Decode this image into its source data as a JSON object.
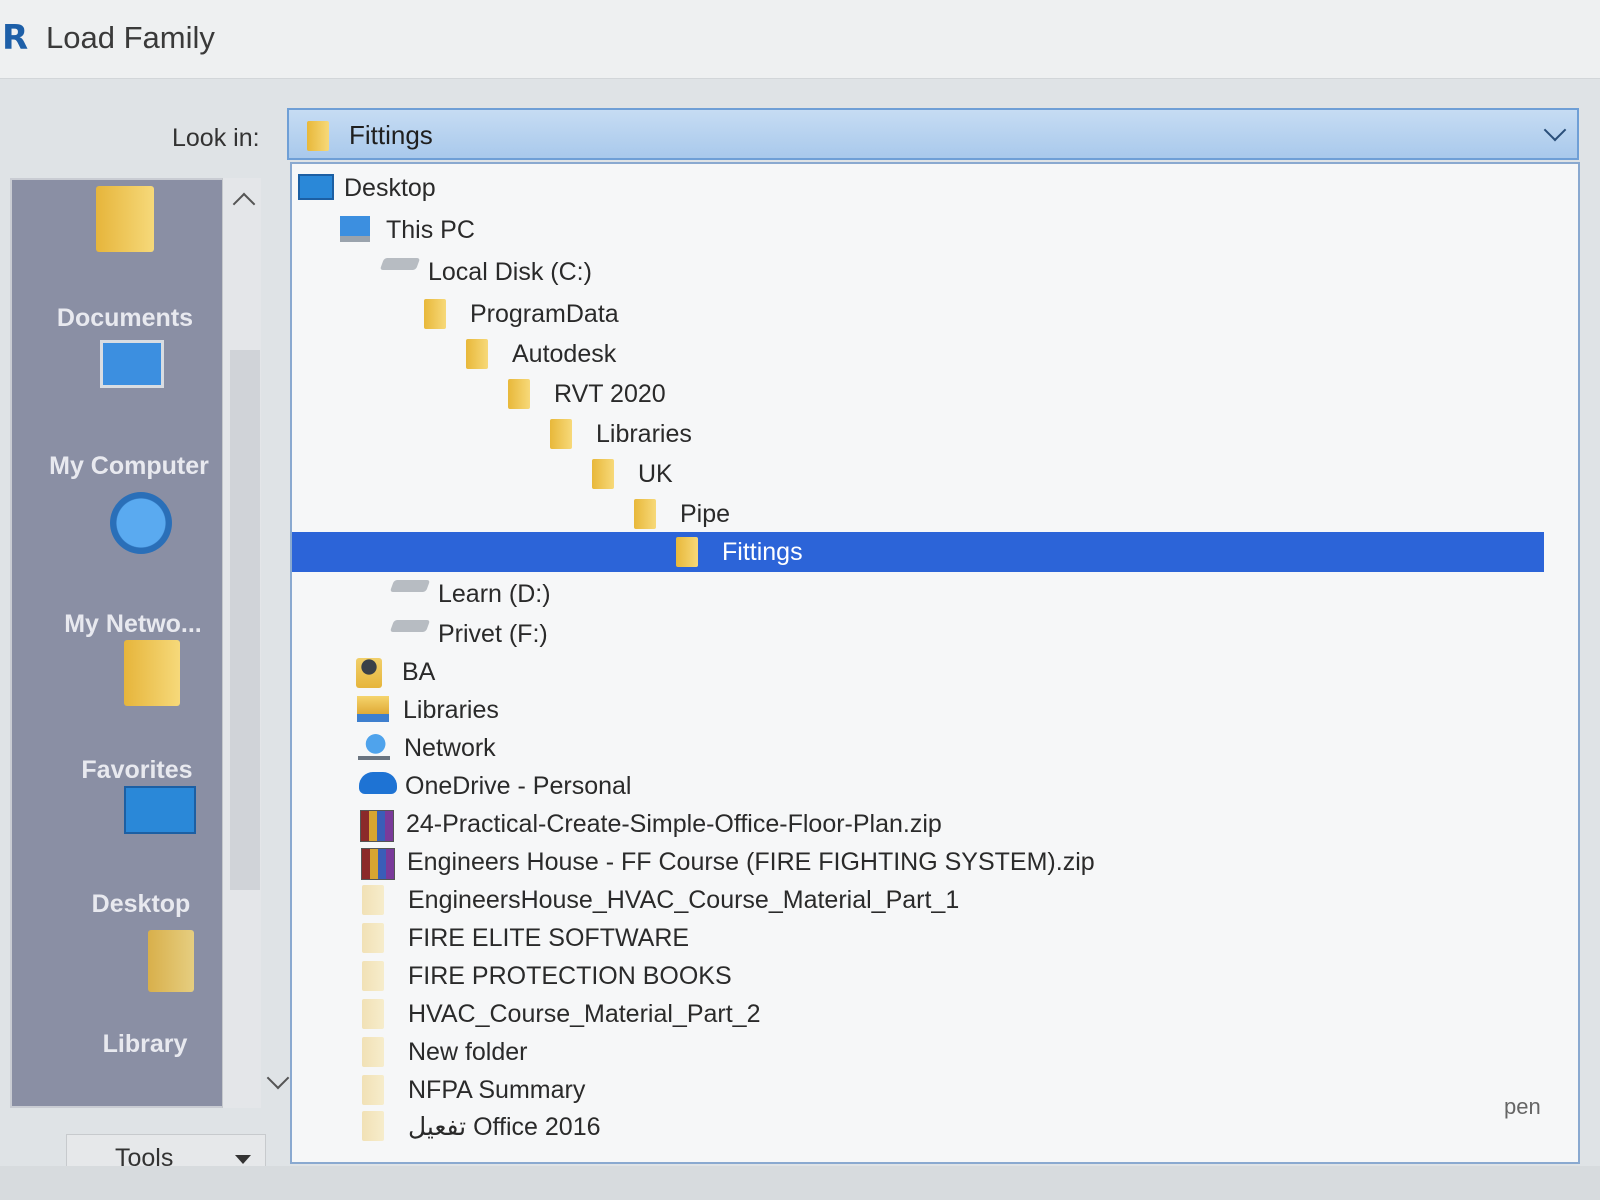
{
  "window": {
    "app_icon": "R",
    "title": "Load Family"
  },
  "look_in": {
    "label": "Look in:",
    "value": "Fittings",
    "icon": "folder-icon"
  },
  "places_bar": {
    "items": [
      {
        "label": "Documents",
        "icon": "documents-folder-icon"
      },
      {
        "label": "My Computer",
        "icon": "computer-icon"
      },
      {
        "label": "My Netwo...",
        "icon": "network-globe-icon"
      },
      {
        "label": "Favorites",
        "icon": "favorites-folder-icon"
      },
      {
        "label": "Desktop",
        "icon": "desktop-icon"
      },
      {
        "label": "Library",
        "icon": "library-folder-icon"
      }
    ]
  },
  "tools": {
    "label": "Tools"
  },
  "dropdown": {
    "items": [
      {
        "label": "Desktop",
        "icon": "desktop-icon",
        "level": 0
      },
      {
        "label": "This PC",
        "icon": "computer-icon",
        "level": 1
      },
      {
        "label": "Local Disk (C:)",
        "icon": "drive-icon",
        "level": 2
      },
      {
        "label": "ProgramData",
        "icon": "folder-icon",
        "level": 3
      },
      {
        "label": "Autodesk",
        "icon": "folder-icon",
        "level": 4
      },
      {
        "label": "RVT 2020",
        "icon": "folder-icon",
        "level": 5
      },
      {
        "label": "Libraries",
        "icon": "folder-icon",
        "level": 6
      },
      {
        "label": "UK",
        "icon": "folder-icon",
        "level": 7
      },
      {
        "label": "Pipe",
        "icon": "folder-icon",
        "level": 8
      },
      {
        "label": "Fittings",
        "icon": "folder-icon",
        "level": 9,
        "selected": true
      },
      {
        "label": "Learn (D:)",
        "icon": "drive-icon",
        "level": 2
      },
      {
        "label": "Privet (F:)",
        "icon": "drive-icon",
        "level": 2
      },
      {
        "label": "BA",
        "icon": "user-folder-icon",
        "level": 1
      },
      {
        "label": "Libraries",
        "icon": "libraries-icon",
        "level": 1
      },
      {
        "label": "Network",
        "icon": "network-icon",
        "level": 1
      },
      {
        "label": "OneDrive - Personal",
        "icon": "onedrive-cloud-icon",
        "level": 1
      },
      {
        "label": "24-Practical-Create-Simple-Office-Floor-Plan.zip",
        "icon": "zip-archive-icon",
        "level": 1
      },
      {
        "label": "Engineers House - FF Course (FIRE FIGHTING SYSTEM).zip",
        "icon": "zip-archive-icon",
        "level": 1
      },
      {
        "label": "EngineersHouse_HVAC_Course_Material_Part_1",
        "icon": "folder-icon",
        "level": 1
      },
      {
        "label": "FIRE ELITE SOFTWARE",
        "icon": "folder-icon",
        "level": 1
      },
      {
        "label": "FIRE PROTECTION BOOKS",
        "icon": "folder-icon",
        "level": 1
      },
      {
        "label": "HVAC_Course_Material_Part_2",
        "icon": "folder-icon",
        "level": 1
      },
      {
        "label": "New folder",
        "icon": "folder-icon",
        "level": 1
      },
      {
        "label": "NFPA Summary",
        "icon": "folder-icon",
        "level": 1
      },
      {
        "label": "تفعيل Office 2016",
        "icon": "folder-icon",
        "level": 1
      }
    ]
  },
  "partial_button": {
    "label": "pen"
  },
  "colors": {
    "selection": "#2c64d8",
    "places_bar": "#8a8fa4",
    "folder": "#e8b83a",
    "combo": "#a9c9ec"
  }
}
